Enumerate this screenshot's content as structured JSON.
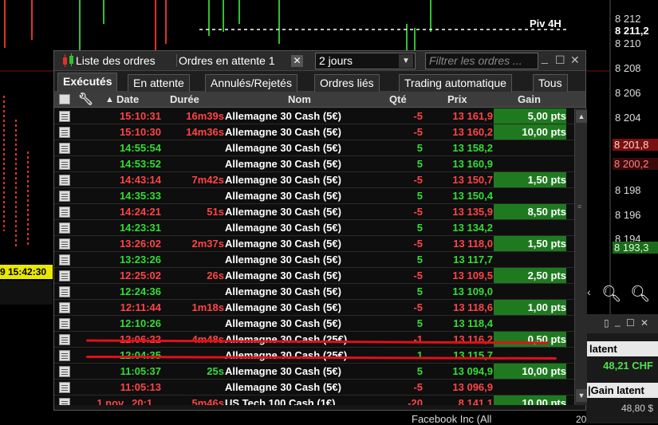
{
  "chart": {
    "price_labels": [
      "8 212",
      "8 210",
      "8 208",
      "8 206",
      "8 204",
      "8 198",
      "8 196",
      "8 194"
    ],
    "current_price": "8 211,2",
    "red_price": "8 201,8",
    "red_price2": "8 200,2",
    "green_price": "8 193,3",
    "pivot_label": "Piv 4H",
    "time_badge": "9 15:42:30"
  },
  "window": {
    "title": "Liste des ordres",
    "pending_label": "Ordres en attente 1",
    "period": "2 jours",
    "filter_placeholder": "Filtrer les ordres ..."
  },
  "tabs": [
    "Exécutés",
    "En attente",
    "Annulés/Rejetés",
    "Ordres liés",
    "Trading automatique",
    "Tous"
  ],
  "columns": {
    "date": "Date",
    "duree": "Durée",
    "nom": "Nom",
    "qte": "Qté",
    "prix": "Prix",
    "gain": "Gain"
  },
  "rows": [
    {
      "date": "15:10:31",
      "duree": "16m39s",
      "nom": "Allemagne 30 Cash (5€)",
      "qte": "-5",
      "prix": "13 161,9",
      "gain": "5,00 pts",
      "side": "sell"
    },
    {
      "date": "15:10:30",
      "duree": "14m36s",
      "nom": "Allemagne 30 Cash (5€)",
      "qte": "-5",
      "prix": "13 160,2",
      "gain": "10,00 pts",
      "side": "sell"
    },
    {
      "date": "14:55:54",
      "duree": "",
      "nom": "Allemagne 30 Cash (5€)",
      "qte": "5",
      "prix": "13 158,2",
      "gain": "",
      "side": "buy"
    },
    {
      "date": "14:53:52",
      "duree": "",
      "nom": "Allemagne 30 Cash (5€)",
      "qte": "5",
      "prix": "13 160,9",
      "gain": "",
      "side": "buy"
    },
    {
      "date": "14:43:14",
      "duree": "7m42s",
      "nom": "Allemagne 30 Cash (5€)",
      "qte": "-5",
      "prix": "13 150,7",
      "gain": "1,50 pts",
      "side": "sell"
    },
    {
      "date": "14:35:33",
      "duree": "",
      "nom": "Allemagne 30 Cash (5€)",
      "qte": "5",
      "prix": "13 150,4",
      "gain": "",
      "side": "buy"
    },
    {
      "date": "14:24:21",
      "duree": "51s",
      "nom": "Allemagne 30 Cash (5€)",
      "qte": "-5",
      "prix": "13 135,9",
      "gain": "8,50 pts",
      "side": "sell"
    },
    {
      "date": "14:23:31",
      "duree": "",
      "nom": "Allemagne 30 Cash (5€)",
      "qte": "5",
      "prix": "13 134,2",
      "gain": "",
      "side": "buy"
    },
    {
      "date": "13:26:02",
      "duree": "2m37s",
      "nom": "Allemagne 30 Cash (5€)",
      "qte": "-5",
      "prix": "13 118,0",
      "gain": "1,50 pts",
      "side": "sell"
    },
    {
      "date": "13:23:26",
      "duree": "",
      "nom": "Allemagne 30 Cash (5€)",
      "qte": "5",
      "prix": "13 117,7",
      "gain": "",
      "side": "buy"
    },
    {
      "date": "12:25:02",
      "duree": "26s",
      "nom": "Allemagne 30 Cash (5€)",
      "qte": "-5",
      "prix": "13 109,5",
      "gain": "2,50 pts",
      "side": "sell"
    },
    {
      "date": "12:24:36",
      "duree": "",
      "nom": "Allemagne 30 Cash (5€)",
      "qte": "5",
      "prix": "13 109,0",
      "gain": "",
      "side": "buy"
    },
    {
      "date": "12:11:44",
      "duree": "1m18s",
      "nom": "Allemagne 30 Cash (5€)",
      "qte": "-5",
      "prix": "13 118,6",
      "gain": "1,00 pts",
      "side": "sell"
    },
    {
      "date": "12:10:26",
      "duree": "",
      "nom": "Allemagne 30 Cash (5€)",
      "qte": "5",
      "prix": "13 118,4",
      "gain": "",
      "side": "buy"
    },
    {
      "date": "12:06:22",
      "duree": "4m48s",
      "nom": "Allemagne 30 Cash (25€)",
      "qte": "-1",
      "prix": "13 116,2",
      "gain": "0,50 pts",
      "side": "sell"
    },
    {
      "date": "12:04:35",
      "duree": "",
      "nom": "Allemagne 30 Cash (25€)",
      "qte": "1",
      "prix": "13 115,7",
      "gain": "",
      "side": "buy"
    },
    {
      "date": "11:05:37",
      "duree": "25s",
      "nom": "Allemagne 30 Cash (5€)",
      "qte": "5",
      "prix": "13 094,9",
      "gain": "10,00 pts",
      "side": "buy"
    },
    {
      "date": "11:05:13",
      "duree": "",
      "nom": "Allemagne 30 Cash (5€)",
      "qte": "-5",
      "prix": "13 096,9",
      "gain": "",
      "side": "sell"
    },
    {
      "date": "1 nov., 20:1...",
      "duree": "5m46s",
      "nom": "US Tech 100 Cash (1€)",
      "qte": "-20",
      "prix": "8 141,1",
      "gain": "10,00 pts",
      "side": "sell"
    }
  ],
  "side_panel": {
    "latent": "latent",
    "latent_value": "48,21 CHF",
    "gain_latent": "|Gain latent",
    "bottom_value": "48,80 $"
  },
  "bottom": {
    "instrument": "Facebook Inc (All",
    "count": "20"
  },
  "colors": {
    "sell": "#ff4444",
    "buy": "#33dd33",
    "gain_bg": "#1f7a1f",
    "red_marker": "#e0101a"
  }
}
